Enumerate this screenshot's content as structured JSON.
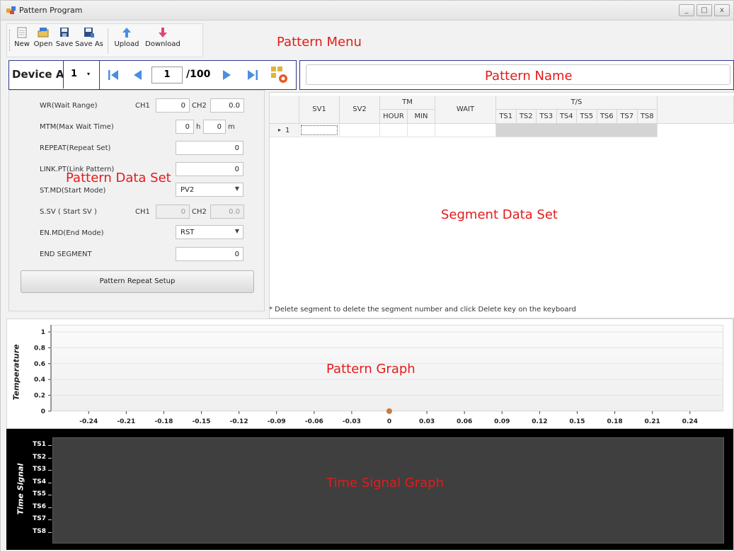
{
  "window": {
    "title": "Pattern Program",
    "controls": [
      "_",
      "□",
      "x"
    ]
  },
  "toolbar": {
    "new_label": "New",
    "open_label": "Open",
    "save_label": "Save",
    "saveas_label": "Save As",
    "upload_label": "Upload",
    "download_label": "Download"
  },
  "annotations": {
    "pattern_menu": "Pattern Menu",
    "pattern_name": "Pattern Name",
    "pattern_data_set": "Pattern Data Set",
    "segment_data_set": "Segment Data Set",
    "pattern_graph": "Pattern Graph",
    "time_signal_graph": "Time Signal Graph"
  },
  "nav": {
    "device_label": "Device A",
    "device_selected": "1",
    "page_current": "1",
    "page_total": "/100"
  },
  "pattern": {
    "name_value": "",
    "wr_label": "WR(Wait Range)",
    "wr_ch1_label": "CH1",
    "wr_ch1_value": "0",
    "wr_ch2_label": "CH2",
    "wr_ch2_value": "0.0",
    "mtm_label": "MTM(Max Wait Time)",
    "mtm_h_value": "0",
    "mtm_h_unit": "h",
    "mtm_m_value": "0",
    "mtm_m_unit": "m",
    "repeat_label": "REPEAT(Repeat Set)",
    "repeat_value": "0",
    "link_label": "LINK.PT(Link Pattern)",
    "link_value": "0",
    "stmd_label": "ST.MD(Start Mode)",
    "stmd_value": "PV2",
    "ssv_label": "S.SV ( Start SV )",
    "ssv_ch1_label": "CH1",
    "ssv_ch1_value": "0",
    "ssv_ch2_label": "CH2",
    "ssv_ch2_value": "0.0",
    "enmd_label": "EN.MD(End Mode)",
    "enmd_value": "RST",
    "endseg_label": "END SEGMENT",
    "endseg_value": "0",
    "repeat_setup_button": "Pattern Repeat Setup"
  },
  "segment_grid": {
    "headers": {
      "sv1": "SV1",
      "sv2": "SV2",
      "tm": "TM",
      "hour": "HOUR",
      "min": "MIN",
      "wait": "WAIT",
      "ts": "T/S"
    },
    "ts_columns": [
      "TS1",
      "TS2",
      "TS3",
      "TS4",
      "TS5",
      "TS6",
      "TS7",
      "TS8"
    ],
    "rows": [
      {
        "marker": "▸",
        "number": "1"
      }
    ],
    "note": "* Delete segment to delete the segment number and click Delete key on the keyboard"
  },
  "chart_data": {
    "type": "scatter",
    "ylabel": "Temperature",
    "y_ticks": [
      "1",
      "0.8",
      "0.6",
      "0.4",
      "0.2",
      "0"
    ],
    "x_ticks": [
      "-0.24",
      "-0.21",
      "-0.18",
      "-0.15",
      "-0.12",
      "-0.09",
      "-0.06",
      "-0.03",
      "0",
      "0.03",
      "0.06",
      "0.09",
      "0.12",
      "0.15",
      "0.18",
      "0.21",
      "0.24"
    ],
    "xlim": [
      -0.265,
      0.265
    ],
    "ylim": [
      0,
      1
    ],
    "points": [
      {
        "x": 0,
        "y": 0
      }
    ],
    "point_color": "#d07a3a"
  },
  "time_signal": {
    "ylabel": "Time Signal",
    "channels": [
      "TS1",
      "TS2",
      "TS3",
      "TS4",
      "TS5",
      "TS6",
      "TS7",
      "TS8"
    ]
  }
}
